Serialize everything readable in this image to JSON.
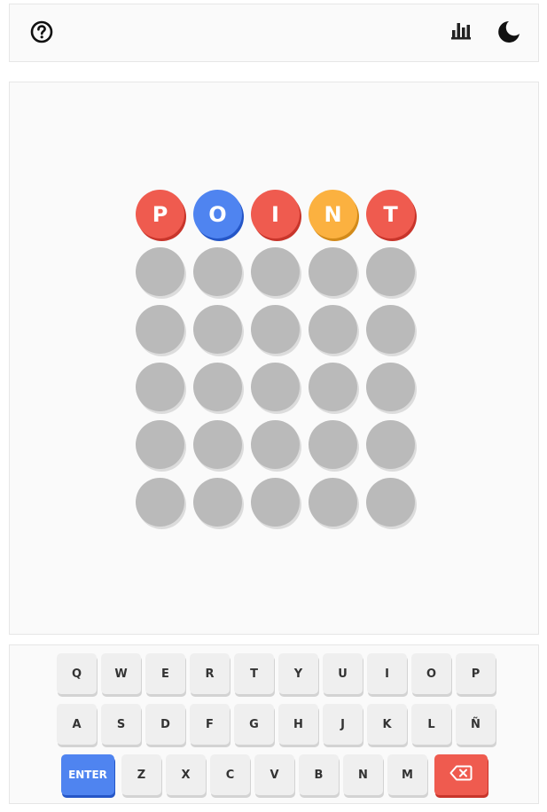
{
  "header": {
    "help_icon": "help-circle-icon",
    "stats_icon": "bar-chart-icon",
    "theme_icon": "moon-icon"
  },
  "board": {
    "rows": [
      [
        {
          "letter": "P",
          "state": "red"
        },
        {
          "letter": "O",
          "state": "blue"
        },
        {
          "letter": "I",
          "state": "red"
        },
        {
          "letter": "N",
          "state": "yellow"
        },
        {
          "letter": "T",
          "state": "red"
        }
      ],
      [
        {
          "letter": "",
          "state": "empty"
        },
        {
          "letter": "",
          "state": "empty"
        },
        {
          "letter": "",
          "state": "empty"
        },
        {
          "letter": "",
          "state": "empty"
        },
        {
          "letter": "",
          "state": "empty"
        }
      ],
      [
        {
          "letter": "",
          "state": "empty"
        },
        {
          "letter": "",
          "state": "empty"
        },
        {
          "letter": "",
          "state": "empty"
        },
        {
          "letter": "",
          "state": "empty"
        },
        {
          "letter": "",
          "state": "empty"
        }
      ],
      [
        {
          "letter": "",
          "state": "empty"
        },
        {
          "letter": "",
          "state": "empty"
        },
        {
          "letter": "",
          "state": "empty"
        },
        {
          "letter": "",
          "state": "empty"
        },
        {
          "letter": "",
          "state": "empty"
        }
      ],
      [
        {
          "letter": "",
          "state": "empty"
        },
        {
          "letter": "",
          "state": "empty"
        },
        {
          "letter": "",
          "state": "empty"
        },
        {
          "letter": "",
          "state": "empty"
        },
        {
          "letter": "",
          "state": "empty"
        }
      ],
      [
        {
          "letter": "",
          "state": "empty"
        },
        {
          "letter": "",
          "state": "empty"
        },
        {
          "letter": "",
          "state": "empty"
        },
        {
          "letter": "",
          "state": "empty"
        },
        {
          "letter": "",
          "state": "empty"
        }
      ]
    ],
    "colors": {
      "red": "#ef5b4f",
      "blue": "#4f84f0",
      "yellow": "#fbb140",
      "empty": "#bababa"
    }
  },
  "keyboard": {
    "row1": [
      "Q",
      "W",
      "E",
      "R",
      "T",
      "Y",
      "U",
      "I",
      "O",
      "P"
    ],
    "row2": [
      "A",
      "S",
      "D",
      "F",
      "G",
      "H",
      "J",
      "K",
      "L",
      "Ñ"
    ],
    "row3": [
      "Z",
      "X",
      "C",
      "V",
      "B",
      "N",
      "M"
    ],
    "enter_label": "ENTER",
    "delete_icon": "backspace-icon"
  }
}
